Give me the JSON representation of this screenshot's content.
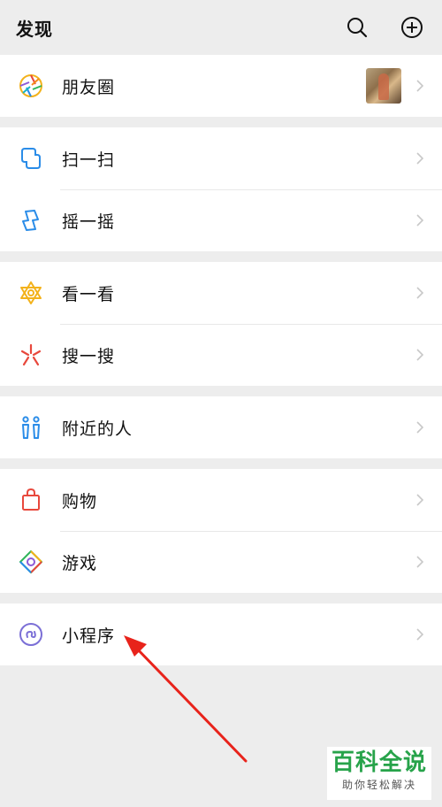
{
  "header": {
    "title": "发现",
    "search_icon": "search-icon",
    "add_icon": "plus-circle-icon"
  },
  "groups": [
    {
      "items": [
        {
          "label": "朋友圈",
          "icon": "moments-aperture-icon",
          "has_thumbnail": true
        }
      ]
    },
    {
      "items": [
        {
          "label": "扫一扫",
          "icon": "scan-icon"
        },
        {
          "label": "摇一摇",
          "icon": "shake-icon"
        }
      ]
    },
    {
      "items": [
        {
          "label": "看一看",
          "icon": "top-stories-icon"
        },
        {
          "label": "搜一搜",
          "icon": "search-sparkle-icon"
        }
      ]
    },
    {
      "items": [
        {
          "label": "附近的人",
          "icon": "people-nearby-icon"
        }
      ]
    },
    {
      "items": [
        {
          "label": "购物",
          "icon": "shopping-bag-icon"
        },
        {
          "label": "游戏",
          "icon": "games-icon"
        }
      ]
    },
    {
      "items": [
        {
          "label": "小程序",
          "icon": "mini-program-icon"
        }
      ]
    }
  ],
  "watermark": {
    "main": "百科全说",
    "sub": "助你轻松解决"
  },
  "colors": {
    "background": "#ededed",
    "annotation_arrow": "#e8231b",
    "watermark_green": "#27a34a"
  }
}
